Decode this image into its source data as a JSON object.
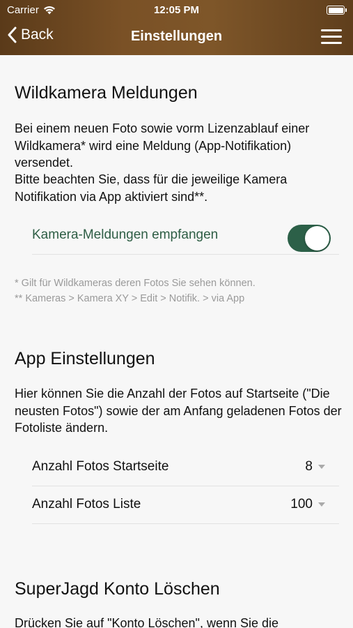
{
  "status_bar": {
    "carrier": "Carrier",
    "time": "12:05 PM"
  },
  "nav": {
    "back_label": "Back",
    "title": "Einstellungen"
  },
  "wildkamera": {
    "heading": "Wildkamera Meldungen",
    "text1": "Bei einem neuen Foto sowie vorm Lizenzablauf einer Wildkamera* wird eine Meldung (App-Notifikation) versendet.",
    "text2": "Bitte beachten Sie, dass für die jeweilige Kamera Notifikation via App aktiviert sind**.",
    "toggle_label": "Kamera-Meldungen empfangen",
    "toggle_on": true,
    "footnote1": "* Gilt für Wildkameras deren Fotos Sie sehen können.",
    "footnote2": "** Kameras > Kamera XY > Edit > Notifik. > via App"
  },
  "app_settings": {
    "heading": "App Einstellungen",
    "text": "Hier können Sie die Anzahl der Fotos auf Startseite (\"Die neusten Fotos\") sowie der am Anfang geladenen Fotos der Fotoliste ändern.",
    "rows": [
      {
        "label": "Anzahl Fotos Startseite",
        "value": "8"
      },
      {
        "label": "Anzahl Fotos Liste",
        "value": "100"
      }
    ]
  },
  "account": {
    "heading": "SuperJagd Konto Löschen",
    "text": "Drücken Sie auf \"Konto Löschen\", wenn Sie die"
  },
  "colors": {
    "header": "#7a5126",
    "toggle_accent": "#2c6048",
    "background": "#f7f7f7"
  }
}
